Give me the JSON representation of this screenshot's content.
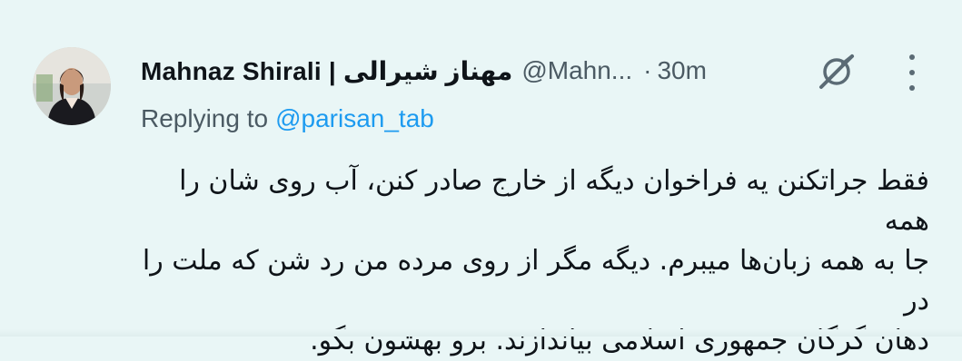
{
  "tweet": {
    "author_name": "Mahnaz Shirali | مهناز شیرالی",
    "handle": "@Mahn...",
    "separator": "·",
    "time": "30m",
    "replying_label": "Replying to",
    "replying_mention": "@parisan_tab",
    "body_lines": [
      "فقط جراتکنن یه فراخوان دیگه از خارج صادر کنن، آب روی شان را همه",
      "جا به همه زبان‌ها میبرم. دیگه مگر از روی مرده من رد شن که ملت را در",
      "دهان گرگان جمهوری اسلامی بیاندازند. برو بهشون بگو."
    ]
  },
  "icons": {
    "avatar": "avatar-photo",
    "grok": "grok-icon",
    "more": "more-icon"
  },
  "colors": {
    "background": "#e9f6f6",
    "text": "#0f1419",
    "muted": "#4b5a63",
    "link": "#1d9bf0"
  }
}
